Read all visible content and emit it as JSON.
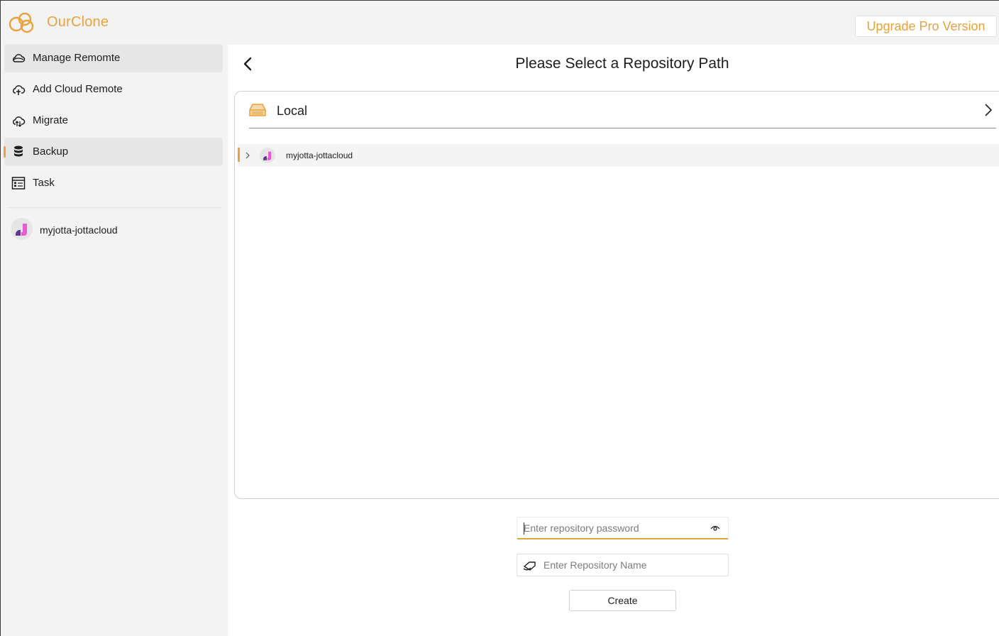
{
  "app": {
    "title": "OurClone",
    "upgrade_label": "Upgrade Pro Version",
    "brand_color": "#e8a23e"
  },
  "sidebar": {
    "items": [
      {
        "label": "Manage Remomte",
        "icon": "cloud-manage-icon"
      },
      {
        "label": "Add Cloud Remote",
        "icon": "cloud-add-icon"
      },
      {
        "label": "Migrate",
        "icon": "cloud-migrate-icon"
      },
      {
        "label": "Backup",
        "icon": "database-icon",
        "active": true
      },
      {
        "label": "Task",
        "icon": "task-list-icon"
      }
    ],
    "remotes": [
      {
        "label": "myjotta-jottacloud",
        "icon": "jottacloud-avatar-icon"
      }
    ]
  },
  "main": {
    "title": "Please Select a Repository Path",
    "local": {
      "label": "Local",
      "icon": "drive-icon"
    },
    "tree": [
      {
        "label": "myjotta-jottacloud",
        "icon": "jottacloud-avatar-icon",
        "expanded": false
      }
    ],
    "password": {
      "value": "",
      "placeholder": "Enter repository password"
    },
    "name": {
      "value": "",
      "placeholder": "Enter Repository Name"
    },
    "create_label": "Create"
  }
}
